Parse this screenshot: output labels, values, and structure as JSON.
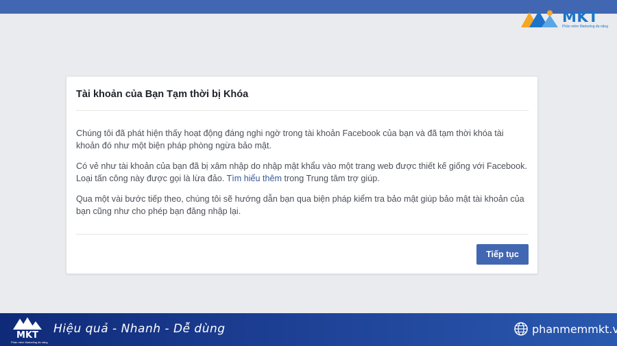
{
  "brand": {
    "name": "MKT",
    "tagline": "Phần mềm Marketing đa năng",
    "accent_color": "#1e73c8"
  },
  "dialog": {
    "title": "Tài khoản của Bạn Tạm thời bị Khóa",
    "paragraph1": "Chúng tôi đã phát hiện thấy hoạt động đáng nghi ngờ trong tài khoản Facebook của bạn và đã tạm thời khóa tài khoản đó như một biện pháp phòng ngừa bảo mật.",
    "paragraph2_before": "Có vẻ như tài khoản của bạn đã bị xâm nhập do nhập mật khẩu vào một trang web được thiết kế giống với Facebook. Loại tấn công này được gọi là lừa đảo.",
    "paragraph2_link": "Tìm hiểu thêm",
    "paragraph2_after": "trong Trung tâm trợ giúp.",
    "paragraph3": "Qua một vài bước tiếp theo, chúng tôi sẽ hướng dẫn bạn qua biện pháp kiểm tra bảo mật giúp bảo mật tài khoản của bạn cũng như cho phép bạn đăng nhập lại.",
    "continue_label": "Tiếp tục"
  },
  "footer": {
    "slogan": "Hiệu quả - Nhanh - Dễ dùng",
    "website": "phanmemmkt.vn",
    "icons": [
      "mkt-logo-icon",
      "globe-icon"
    ]
  },
  "colors": {
    "facebook_blue": "#4267b2",
    "page_background": "#e9ebee",
    "link": "#365899"
  }
}
